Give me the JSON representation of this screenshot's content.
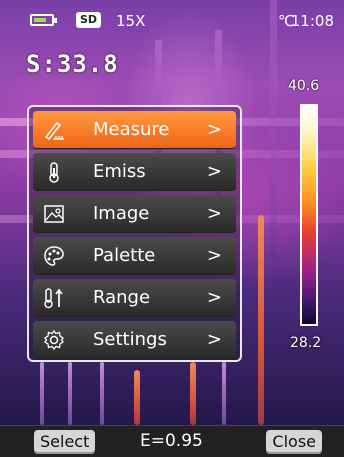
{
  "status": {
    "sd_label": "SD",
    "zoom": "15X",
    "unit": "℃",
    "time": "11:08"
  },
  "readout": {
    "spot": "S:33.8",
    "scale_max": "40.6",
    "scale_min": "28.2"
  },
  "menu": {
    "items": [
      {
        "label": "Measure",
        "icon": "measure-icon",
        "active": true
      },
      {
        "label": "Emiss",
        "icon": "thermometer-icon",
        "active": false
      },
      {
        "label": "Image",
        "icon": "image-icon",
        "active": false
      },
      {
        "label": "Palette",
        "icon": "palette-icon",
        "active": false
      },
      {
        "label": "Range",
        "icon": "range-icon",
        "active": false
      },
      {
        "label": "Settings",
        "icon": "gear-icon",
        "active": false
      }
    ],
    "chevron": ">"
  },
  "bottom": {
    "left_key": "Select",
    "emissivity": "E=0.95",
    "right_key": "Close"
  },
  "colors": {
    "active_item": "#f06418",
    "item_bg": "#2a2a2a",
    "battery": "#9be24a"
  }
}
